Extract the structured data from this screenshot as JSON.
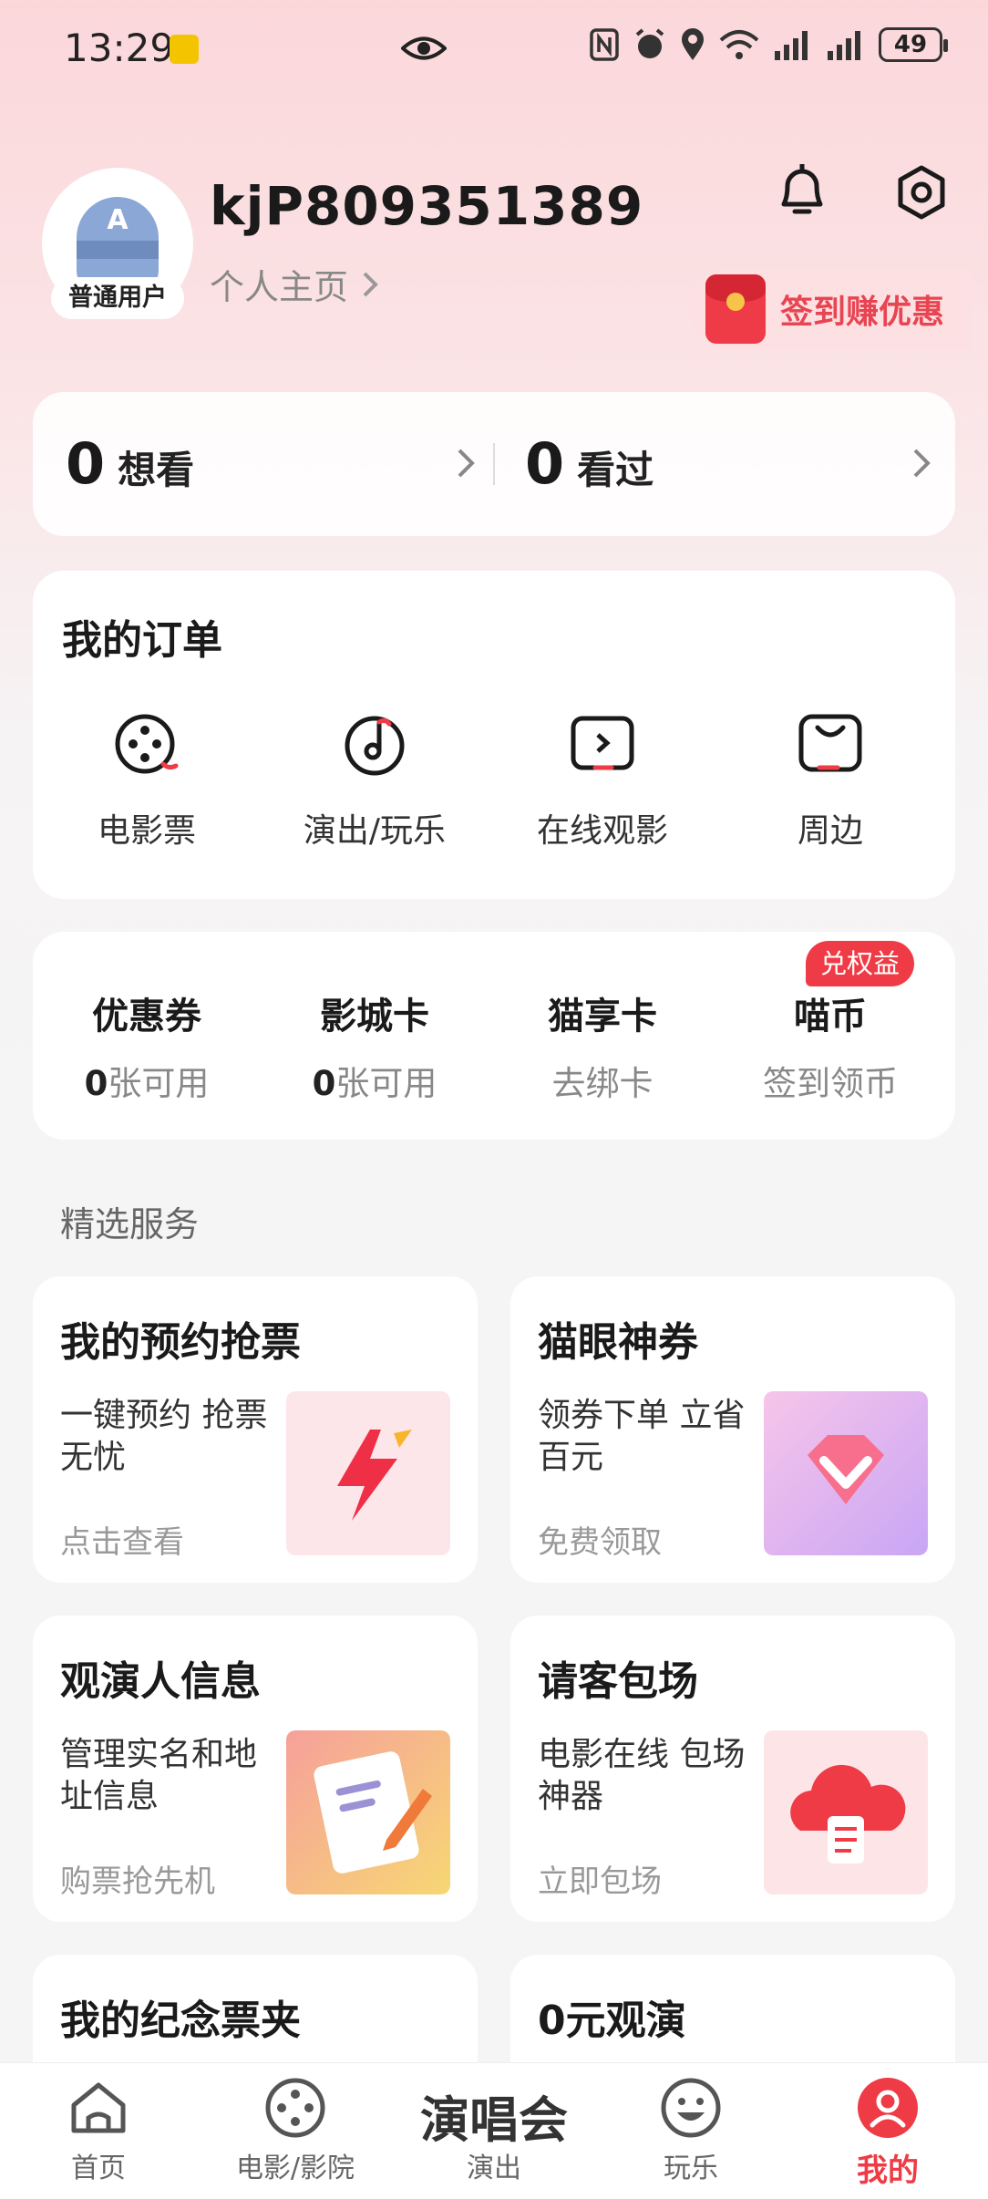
{
  "status_bar": {
    "time": "13:29",
    "battery": "49"
  },
  "profile": {
    "username": "kjP809351389",
    "avatar_letter": "A",
    "user_tag": "普通用户",
    "homepage_link": "个人主页",
    "checkin_label": "签到赚优惠"
  },
  "stats": {
    "want": {
      "count": "0",
      "label": "想看"
    },
    "seen": {
      "count": "0",
      "label": "看过"
    }
  },
  "orders": {
    "title": "我的订单",
    "items": [
      {
        "label": "电影票",
        "icon": "film-reel-icon"
      },
      {
        "label": "演出/玩乐",
        "icon": "music-note-icon"
      },
      {
        "label": "在线观影",
        "icon": "play-screen-icon"
      },
      {
        "label": "周边",
        "icon": "bag-icon"
      }
    ]
  },
  "benefits": {
    "badge": "兑权益",
    "items": [
      {
        "title": "优惠券",
        "count": "0",
        "sub": "张可用"
      },
      {
        "title": "影城卡",
        "count": "0",
        "sub": "张可用"
      },
      {
        "title": "猫享卡",
        "count": "",
        "sub": "去绑卡"
      },
      {
        "title": "喵币",
        "count": "",
        "sub": "签到领币"
      }
    ]
  },
  "services": {
    "section_label": "精选服务",
    "cards": [
      {
        "title": "我的预约抢票",
        "desc": "一键预约 抢票无忧",
        "link": "点击查看",
        "icon": "lightning-icon"
      },
      {
        "title": "猫眼神券",
        "desc": "领券下单 立省百元",
        "link": "免费领取",
        "icon": "diamond-coupon-icon"
      },
      {
        "title": "观演人信息",
        "desc": "管理实名和地址信息",
        "link": "购票抢先机",
        "icon": "clipboard-pen-icon"
      },
      {
        "title": "请客包场",
        "desc": "电影在线 包场神器",
        "link": "立即包场",
        "icon": "cloud-ticket-icon"
      },
      {
        "title": "我的纪念票夹",
        "desc": "",
        "link": "",
        "icon": ""
      },
      {
        "title": "0元观演",
        "desc": "",
        "link": "",
        "icon": ""
      }
    ]
  },
  "bottom_nav": {
    "active": "我的",
    "items": [
      {
        "label": "首页",
        "icon": "home-icon"
      },
      {
        "label": "电影/影院",
        "icon": "film-reel-icon"
      },
      {
        "label": "演出",
        "big": "演唱会"
      },
      {
        "label": "玩乐",
        "icon": "smile-icon"
      },
      {
        "label": "我的",
        "icon": "user-icon"
      }
    ]
  },
  "colors": {
    "accent": "#ef3b45",
    "background_top": "#fbd7da"
  }
}
